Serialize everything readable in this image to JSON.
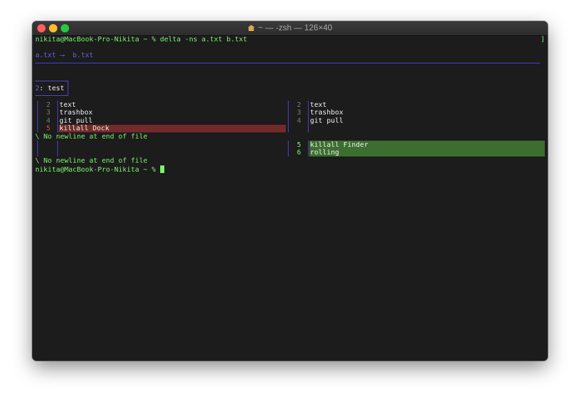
{
  "window": {
    "title": "~ — -zsh — 126×40",
    "home_icon": "home-icon"
  },
  "terminal": {
    "command_line": "nikita@MacBook-Pro-Nikita ~ % delta -ns a.txt b.txt",
    "right_marker": "]",
    "file_header": "a.txt ⟶  b.txt",
    "hunk_number": "2",
    "hunk_label": ": test",
    "left": [
      {
        "num": "2",
        "text": "text"
      },
      {
        "num": "3",
        "text": "trashbox"
      },
      {
        "num": "4",
        "text": "git pull"
      },
      {
        "num": "5",
        "text": "killall Dock"
      }
    ],
    "right": [
      {
        "num": "2",
        "text": "text"
      },
      {
        "num": "3",
        "text": "trashbox"
      },
      {
        "num": "4",
        "text": "git pull"
      },
      {
        "num": "5",
        "text": "killall Finder"
      },
      {
        "num": "6",
        "text": "rolling"
      }
    ],
    "no_newline_1": "\\ No newline at end of file",
    "no_newline_2": "\\ No newline at end of file",
    "prompt": "nikita@MacBook-Pro-Nikita ~ % ",
    "colors": {
      "prompt_green": "#7ef46f",
      "header_purple": "#6d5fe0",
      "minus_bg": "#732a2a",
      "plus_bg": "#3c6e2f"
    }
  }
}
